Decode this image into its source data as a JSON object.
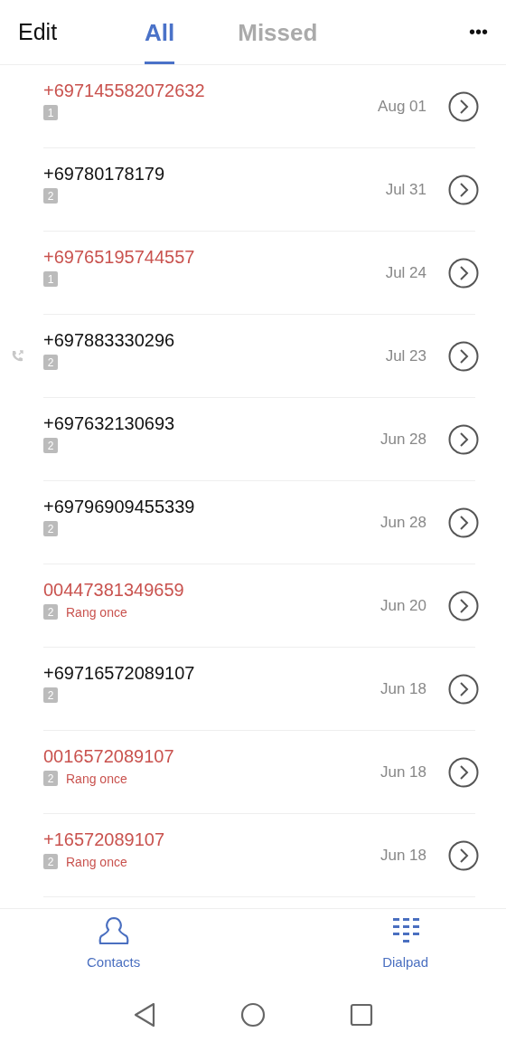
{
  "header": {
    "edit": "Edit",
    "more": "•••"
  },
  "tabs": [
    {
      "label": "All",
      "selected": true
    },
    {
      "label": "Missed",
      "selected": false
    }
  ],
  "calls": [
    {
      "number": "+697145582072632",
      "sim": "1",
      "date": "Aug 01",
      "missed": true,
      "call_icon": false
    },
    {
      "number": "+69780178179",
      "sim": "2",
      "date": "Jul 31",
      "missed": false,
      "call_icon": false
    },
    {
      "number": "+69765195744557",
      "sim": "1",
      "date": "Jul 24",
      "missed": true,
      "call_icon": false
    },
    {
      "number": "+697883330296",
      "sim": "2",
      "date": "Jul 23",
      "missed": false,
      "call_icon": true
    },
    {
      "number": "+697632130693",
      "sim": "2",
      "date": "Jun 28",
      "missed": false,
      "call_icon": false
    },
    {
      "number": "+69796909455339",
      "sim": "2",
      "date": "Jun 28",
      "missed": false,
      "call_icon": false
    },
    {
      "number": "00447381349659",
      "sim": "2",
      "note": "Rang once",
      "date": "Jun 20",
      "missed": true,
      "call_icon": false
    },
    {
      "number": "+69716572089107",
      "sim": "2",
      "date": "Jun 18",
      "missed": false,
      "call_icon": false
    },
    {
      "number": "0016572089107",
      "sim": "2",
      "note": "Rang once",
      "date": "Jun 18",
      "missed": true,
      "call_icon": false
    },
    {
      "number": "+16572089107",
      "sim": "2",
      "note": "Rang once",
      "date": "Jun 18",
      "missed": true,
      "call_icon": false
    }
  ],
  "bottom_nav": [
    {
      "kind": "contacts",
      "label": "Contacts"
    },
    {
      "kind": "dialpad",
      "label": "Dialpad"
    }
  ]
}
